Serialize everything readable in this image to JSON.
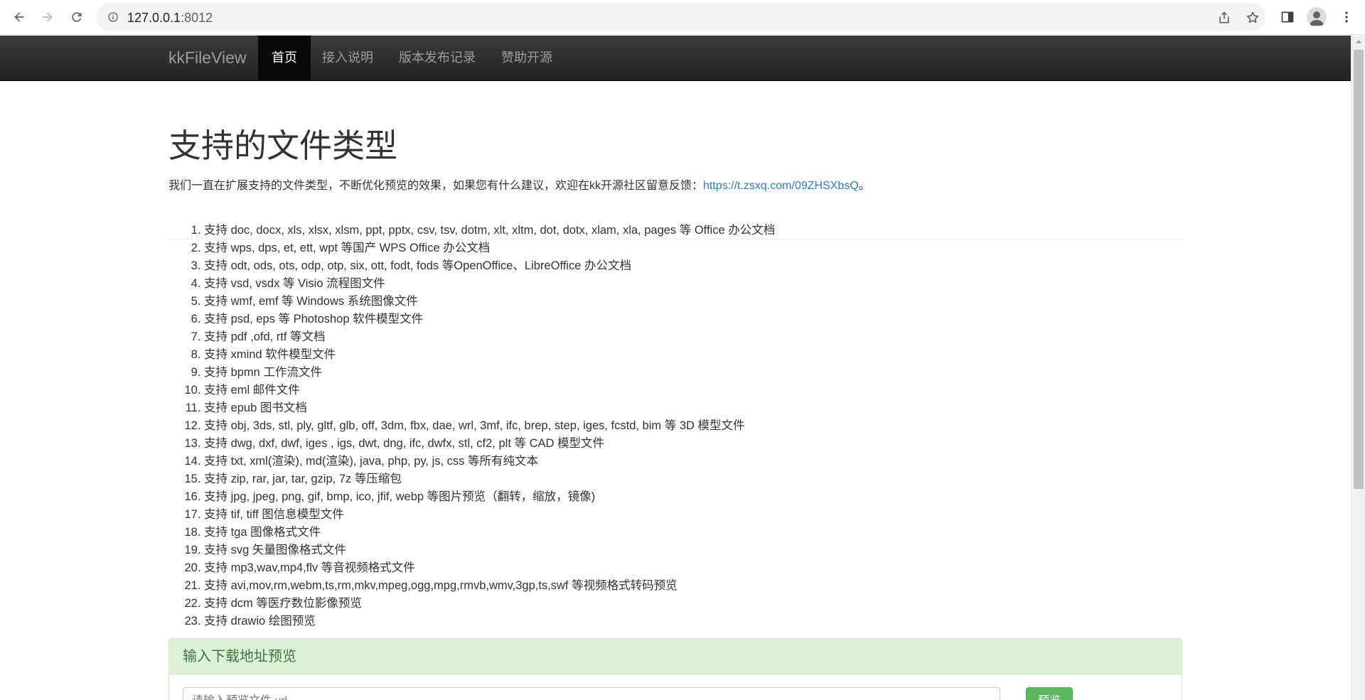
{
  "browser": {
    "url_host": "127.0.0.1",
    "url_port": ":8012"
  },
  "navbar": {
    "brand": "kkFileView",
    "items": [
      {
        "label": "首页",
        "active": true
      },
      {
        "label": "接入说明",
        "active": false
      },
      {
        "label": "版本发布记录",
        "active": false
      },
      {
        "label": "赞助开源",
        "active": false
      }
    ]
  },
  "header": {
    "title": "支持的文件类型",
    "description": "我们一直在扩展支持的文件类型，不断优化预览的效果，如果您有什么建议，欢迎在kk开源社区留意反馈：",
    "link": "https://t.zsxq.com/09ZHSXbsQ",
    "suffix": "。"
  },
  "file_types": [
    "支持 doc, docx, xls, xlsx, xlsm, ppt, pptx, csv, tsv, dotm, xlt, xltm, dot, dotx, xlam, xla, pages 等 Office 办公文档",
    "支持 wps, dps, et, ett, wpt 等国产 WPS Office 办公文档",
    "支持 odt, ods, ots, odp, otp, six, ott, fodt, fods 等OpenOffice、LibreOffice 办公文档",
    "支持 vsd, vsdx 等 Visio 流程图文件",
    "支持 wmf, emf 等 Windows 系统图像文件",
    "支持 psd, eps 等 Photoshop 软件模型文件",
    "支持 pdf ,ofd, rtf 等文档",
    "支持 xmind 软件模型文件",
    "支持 bpmn 工作流文件",
    "支持 eml 邮件文件",
    "支持 epub 图书文档",
    "支持 obj, 3ds, stl, ply, gltf, glb, off, 3dm, fbx, dae, wrl, 3mf, ifc, brep, step, iges, fcstd, bim 等 3D 模型文件",
    "支持 dwg, dxf, dwf, iges , igs, dwt, dng, ifc, dwfx, stl, cf2, plt 等 CAD 模型文件",
    "支持 txt, xml(渲染), md(渲染), java, php, py, js, css 等所有纯文本",
    "支持 zip, rar, jar, tar, gzip, 7z 等压缩包",
    "支持 jpg, jpeg, png, gif, bmp, ico, jfif, webp 等图片预览（翻转，缩放，镜像)",
    "支持 tif, tiff 图信息模型文件",
    "支持 tga 图像格式文件",
    "支持 svg 矢量图像格式文件",
    "支持 mp3,wav,mp4,flv 等音视频格式文件",
    "支持 avi,mov,rm,webm,ts,rm,mkv,mpeg,ogg,mpg,rmvb,wmv,3gp,ts,swf 等视频格式转码预览",
    "支持 dcm 等医疗数位影像预览",
    "支持 drawio 绘图预览"
  ],
  "preview_panel": {
    "heading": "输入下载地址预览",
    "input_placeholder": "请输入预览文件 url",
    "button_label": "预览"
  }
}
